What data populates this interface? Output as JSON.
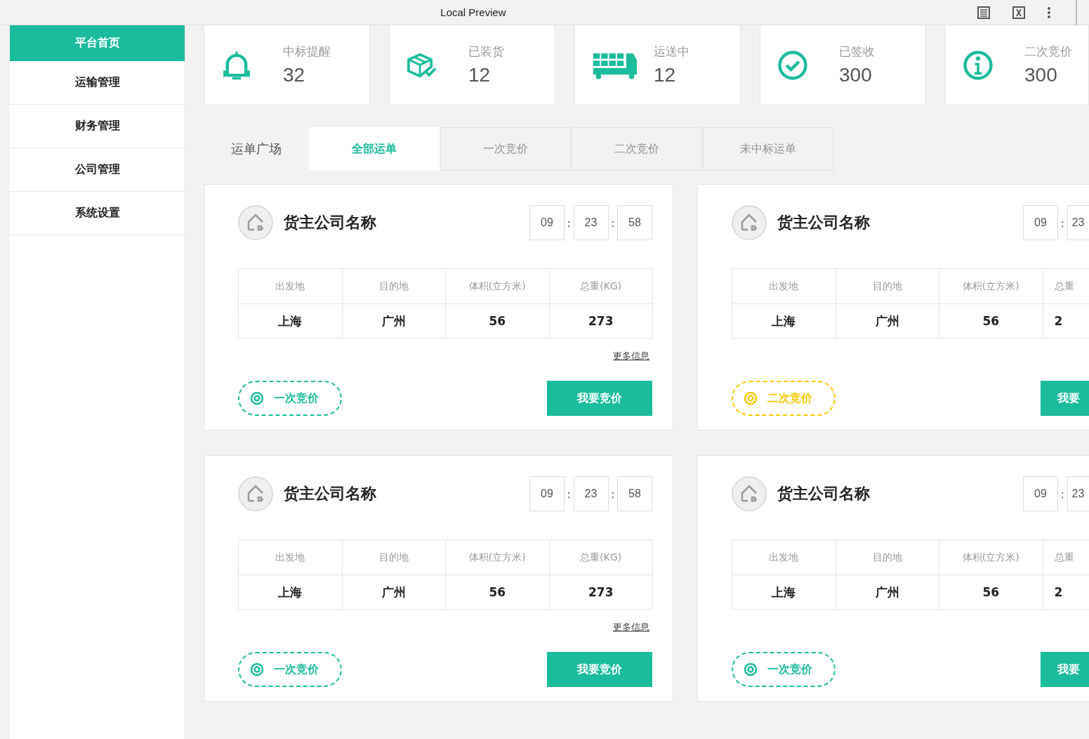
{
  "window": {
    "title": "Local Preview"
  },
  "sidebar": {
    "items": [
      {
        "label": "平台首页",
        "selected": true
      },
      {
        "label": "运输管理",
        "selected": false
      },
      {
        "label": "财务管理",
        "selected": false
      },
      {
        "label": "公司管理",
        "selected": false
      },
      {
        "label": "系统设置",
        "selected": false
      }
    ]
  },
  "stats": [
    {
      "kind": "bell",
      "label": "中标提醒",
      "value": "32"
    },
    {
      "kind": "box",
      "label": "已装货",
      "value": "12"
    },
    {
      "kind": "truck",
      "label": "运送中",
      "value": "12"
    },
    {
      "kind": "check",
      "label": "已签收",
      "value": "300"
    },
    {
      "kind": "info",
      "label": "二次竞价",
      "value": "300"
    }
  ],
  "section_title": "运单广场",
  "tabs": [
    {
      "label": "全部运单",
      "selected": true
    },
    {
      "label": "一次竞价",
      "selected": false
    },
    {
      "label": "二次竞价",
      "selected": false
    },
    {
      "label": "未中标运单",
      "selected": false
    }
  ],
  "orders": [
    {
      "company": "货主公司名称",
      "timer": [
        "09",
        "23",
        "58"
      ],
      "timer_separator": ":",
      "columns": [
        "出发地",
        "目的地",
        "体积(立方米)",
        "总重(KG)"
      ],
      "values": [
        "上海",
        "广州",
        "56",
        "273"
      ],
      "more_link": "更多信息",
      "stage": {
        "label": "一次竞价",
        "color": "#1abc9c"
      },
      "action": "我要竞价"
    },
    {
      "company": "货主公司名称",
      "timer": [
        "09",
        "23"
      ],
      "timer_separator": ":",
      "columns": [
        "出发地",
        "目的地",
        "体积(立方米)",
        "总重"
      ],
      "values": [
        "上海",
        "广州",
        "56",
        "2"
      ],
      "stage": {
        "label": "二次竞价",
        "color": "#fcc800"
      },
      "action": "我要"
    },
    {
      "company": "货主公司名称",
      "timer": [
        "09",
        "23",
        "58"
      ],
      "timer_separator": ":",
      "columns": [
        "出发地",
        "目的地",
        "体积(立方米)",
        "总重(KG)"
      ],
      "values": [
        "上海",
        "广州",
        "56",
        "273"
      ],
      "more_link": "更多信息",
      "stage": {
        "label": "一次竞价",
        "color": "#1abc9c"
      },
      "action": "我要竞价"
    },
    {
      "company": "货主公司名称",
      "timer": [
        "09",
        "23"
      ],
      "timer_separator": ":",
      "columns": [
        "出发地",
        "目的地",
        "体积(立方米)",
        "总重"
      ],
      "values": [
        "上海",
        "广州",
        "56",
        "2"
      ],
      "stage": {
        "label": "一次竞价",
        "color": "#1abc9c"
      },
      "action": "我要"
    }
  ]
}
